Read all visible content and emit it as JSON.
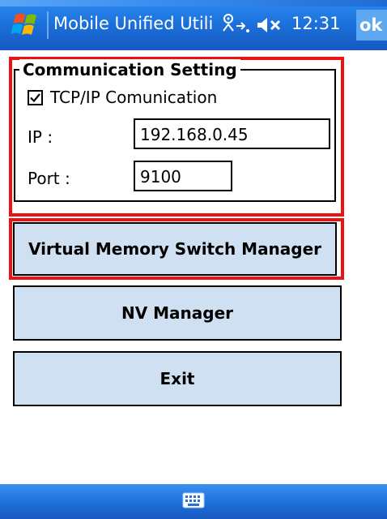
{
  "title_bar": {
    "app_title": "Mobile Unified Utili",
    "time": "12:31",
    "ok_label": "ok",
    "icons": [
      "windows-start-icon",
      "connectivity-icon",
      "volume-muted-icon"
    ]
  },
  "communication_setting": {
    "group_title": "Communication Setting",
    "tcp_checkbox_label": "TCP/IP Comunication",
    "tcp_checked": true,
    "ip_label": "IP :",
    "ip_value": "192.168.0.45",
    "port_label": "Port :",
    "port_value": "9100"
  },
  "buttons": {
    "virtual_memory": "Virtual Memory Switch Manager",
    "nv_manager": "NV Manager",
    "exit": "Exit"
  },
  "bottom_bar": {
    "icons": [
      "keyboard-icon"
    ]
  },
  "colors": {
    "highlight": "#ee1111",
    "button_fill": "#cfe0f2",
    "title_bar": "#1c6fd9"
  }
}
